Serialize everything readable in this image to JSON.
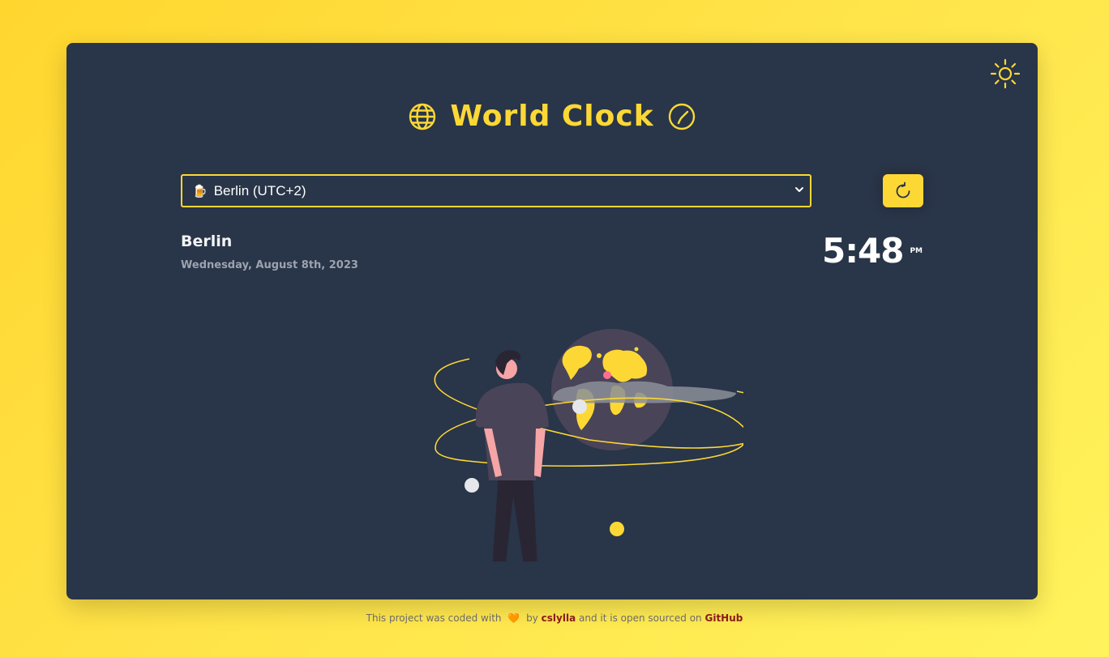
{
  "app": {
    "title": "World Clock",
    "accent_color": "#fdd835",
    "card_color": "#293548"
  },
  "header": {
    "theme_toggle_icon": "sun-icon",
    "title_left_icon": "globe-icon",
    "title_right_icon": "clock-icon"
  },
  "timezone_select": {
    "selected_emoji": "🍺",
    "selected_label": "Berlin (UTC+2)",
    "chevron_icon": "chevron-down-icon"
  },
  "refresh_button": {
    "icon": "refresh-icon"
  },
  "location": {
    "city": "Berlin",
    "date": "Wednesday, August 8th, 2023"
  },
  "clock": {
    "time": "5:48",
    "period": "PM"
  },
  "footer": {
    "text_before": "This project was coded with",
    "heart": "🧡",
    "by": "by",
    "author": "cslylla",
    "text_middle": "and it is open sourced on",
    "repo_link": "GitHub"
  }
}
